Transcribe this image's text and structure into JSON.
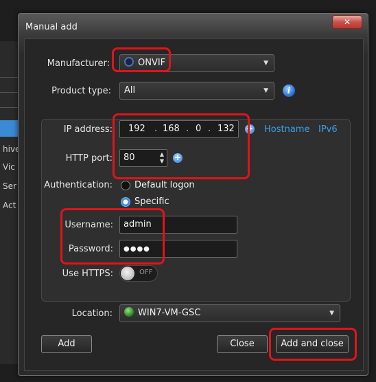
{
  "window": {
    "title": "Manual add",
    "close_glyph": "✕"
  },
  "background_fragments": [
    "hive",
    "Vic",
    "Ser",
    "Act"
  ],
  "form": {
    "manufacturer": {
      "label": "Manufacturer:",
      "value": "ONVIF",
      "icon": "onvif-icon"
    },
    "product_type": {
      "label": "Product type:",
      "value": "All"
    },
    "ip_address": {
      "label": "IP address:",
      "octets": [
        "192",
        "168",
        "0",
        "132"
      ]
    },
    "links": {
      "hostname": "Hostname",
      "ipv6": "IPv6"
    },
    "http_port": {
      "label": "HTTP port:",
      "value": "80"
    },
    "authentication": {
      "label": "Authentication:",
      "options": [
        "Default logon",
        "Specific"
      ],
      "selected": "Specific"
    },
    "username": {
      "label": "Username:",
      "value": "admin"
    },
    "password": {
      "label": "Password:",
      "value": "●●●●"
    },
    "use_https": {
      "label": "Use HTTPS:",
      "state": "OFF"
    },
    "location": {
      "label": "Location:",
      "value": "WIN7-VM-GSC",
      "icon": "globe-icon"
    }
  },
  "buttons": {
    "add": "Add",
    "close": "Close",
    "add_and_close": "Add and close"
  },
  "colors": {
    "highlight": "#e0141b",
    "link": "#3aa0e8",
    "accent": "#3b8de0"
  }
}
